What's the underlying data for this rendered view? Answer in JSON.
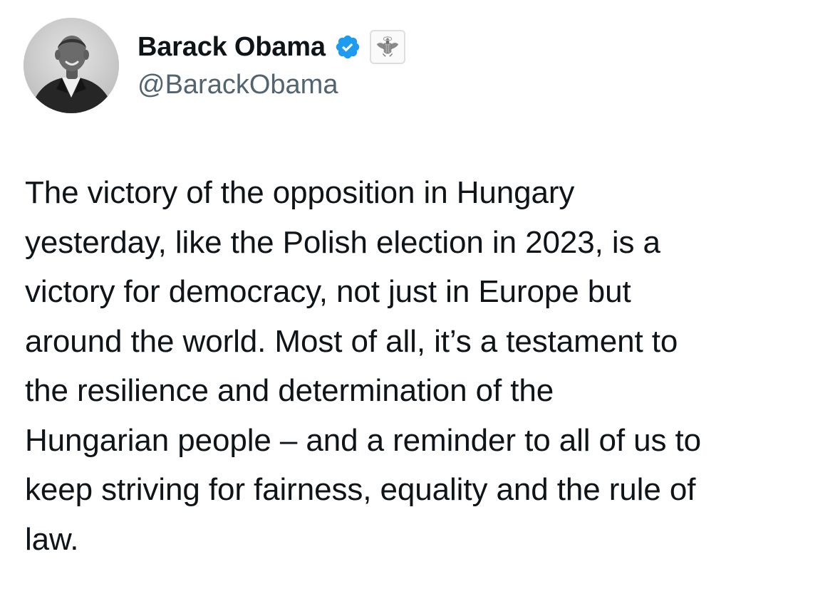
{
  "author": {
    "display_name": "Barack Obama",
    "handle": "@BarackObama",
    "verified": true,
    "avatar_icon": "profile-photo",
    "affiliate_icon": "us-seal-icon",
    "verified_color": "#1d9bf0"
  },
  "tweet": {
    "lines": [
      "The victory of the opposition in Hungary",
      "yesterday, like the Polish election in 2023, is a",
      "victory for democracy, not just in Europe but",
      "around the world. Most of all, it’s a testament to",
      "the resilience and determination of the",
      "Hungarian people – and a reminder to all of us to",
      "keep striving for fairness, equality and the rule of",
      "law."
    ]
  },
  "colors": {
    "text": "#0f1419",
    "secondary": "#536471",
    "background": "#ffffff"
  }
}
